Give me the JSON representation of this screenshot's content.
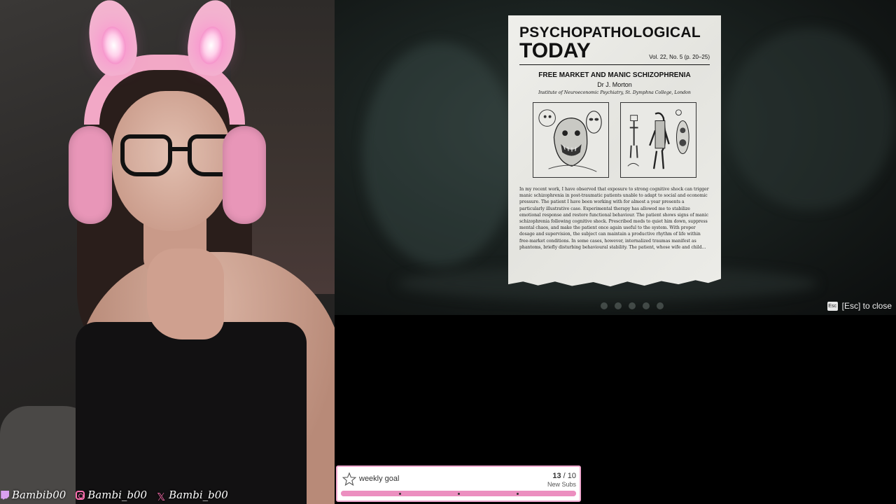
{
  "overlay": {
    "socials": [
      {
        "platform": "twitch",
        "icon": "twitch-icon",
        "handle": "Bambib00"
      },
      {
        "platform": "instagram",
        "icon": "instagram-icon",
        "handle": "Bambi_b00"
      },
      {
        "platform": "x",
        "icon": "x-icon",
        "handle": "Bambi_b00"
      }
    ],
    "goal": {
      "label": "weekly goal",
      "current": "13",
      "target": "10",
      "unit": "New Subs",
      "progress": 1.0,
      "bar_color": "#ec8fc0",
      "border_color": "#f0a9cf"
    }
  },
  "game": {
    "esc_key": "Esc",
    "close_hint": "[Esc] to close",
    "journal": {
      "masthead_line1": "PSYCHOPATHOLOGICAL",
      "masthead_line2": "TODAY",
      "volume": "Vol. 22, No. 5 (p. 20–25)",
      "article_title": "FREE MARKET AND MANIC SCHIZOPHRENIA",
      "author": "Dr J. Morton",
      "institution": "Institute of Neuroeconomic Psychiatry, St. Dymphna College, London",
      "body": "In my recent work, I have observed that exposure to strong cognitive shock can trigger manic schizophrenia in post-traumatic patients unable to adapt to social and economic pressure. The patient I have been working with for almost a year presents a particularly illustrative case. Experimental therapy has allowed me to stabilize emotional response and restore functional behaviour. The patient shows signs of manic schizophrenia following cognitive shock. Prescribed meds to quiet him down, suppress mental chaos, and make the patient once again useful to the system. With proper dosage and supervision, the subject can maintain a productive rhythm of life within free-market conditions. In some cases, however, internalized traumas manifest as phantoms, briefly disturbing behavioural stability. The patient, whose wife and child..."
    }
  }
}
